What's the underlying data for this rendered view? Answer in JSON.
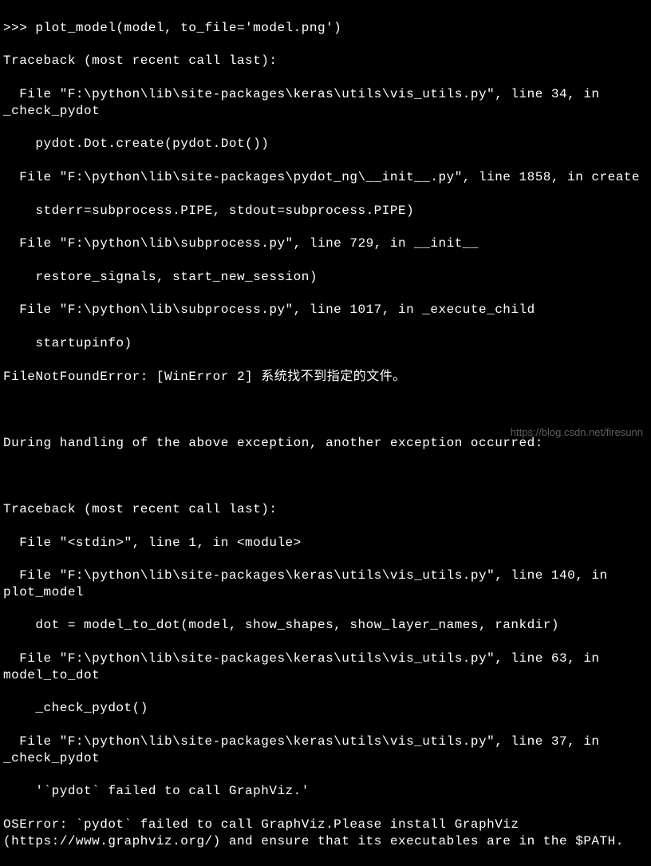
{
  "terminal": {
    "lines": [
      ">>> plot_model(model, to_file='model.png')",
      "Traceback (most recent call last):",
      "  File \"F:\\python\\lib\\site-packages\\keras\\utils\\vis_utils.py\", line 34, in _check_pydot",
      "    pydot.Dot.create(pydot.Dot())",
      "  File \"F:\\python\\lib\\site-packages\\pydot_ng\\__init__.py\", line 1858, in create",
      "    stderr=subprocess.PIPE, stdout=subprocess.PIPE)",
      "  File \"F:\\python\\lib\\subprocess.py\", line 729, in __init__",
      "    restore_signals, start_new_session)",
      "  File \"F:\\python\\lib\\subprocess.py\", line 1017, in _execute_child",
      "    startupinfo)",
      "FileNotFoundError: [WinError 2] 系统找不到指定的文件。",
      "",
      "During handling of the above exception, another exception occurred:",
      "",
      "Traceback (most recent call last):",
      "  File \"<stdin>\", line 1, in <module>",
      "  File \"F:\\python\\lib\\site-packages\\keras\\utils\\vis_utils.py\", line 140, in plot_model",
      "    dot = model_to_dot(model, show_shapes, show_layer_names, rankdir)",
      "  File \"F:\\python\\lib\\site-packages\\keras\\utils\\vis_utils.py\", line 63, in model_to_dot",
      "    _check_pydot()",
      "  File \"F:\\python\\lib\\site-packages\\keras\\utils\\vis_utils.py\", line 37, in _check_pydot",
      "    '`pydot` failed to call GraphViz.'",
      "OSError: `pydot` failed to call GraphViz.Please install GraphViz (https://www.graphviz.org/) and ensure that its executables are in the $PATH."
    ]
  },
  "watermark": "https://blog.csdn.net/firesunn"
}
